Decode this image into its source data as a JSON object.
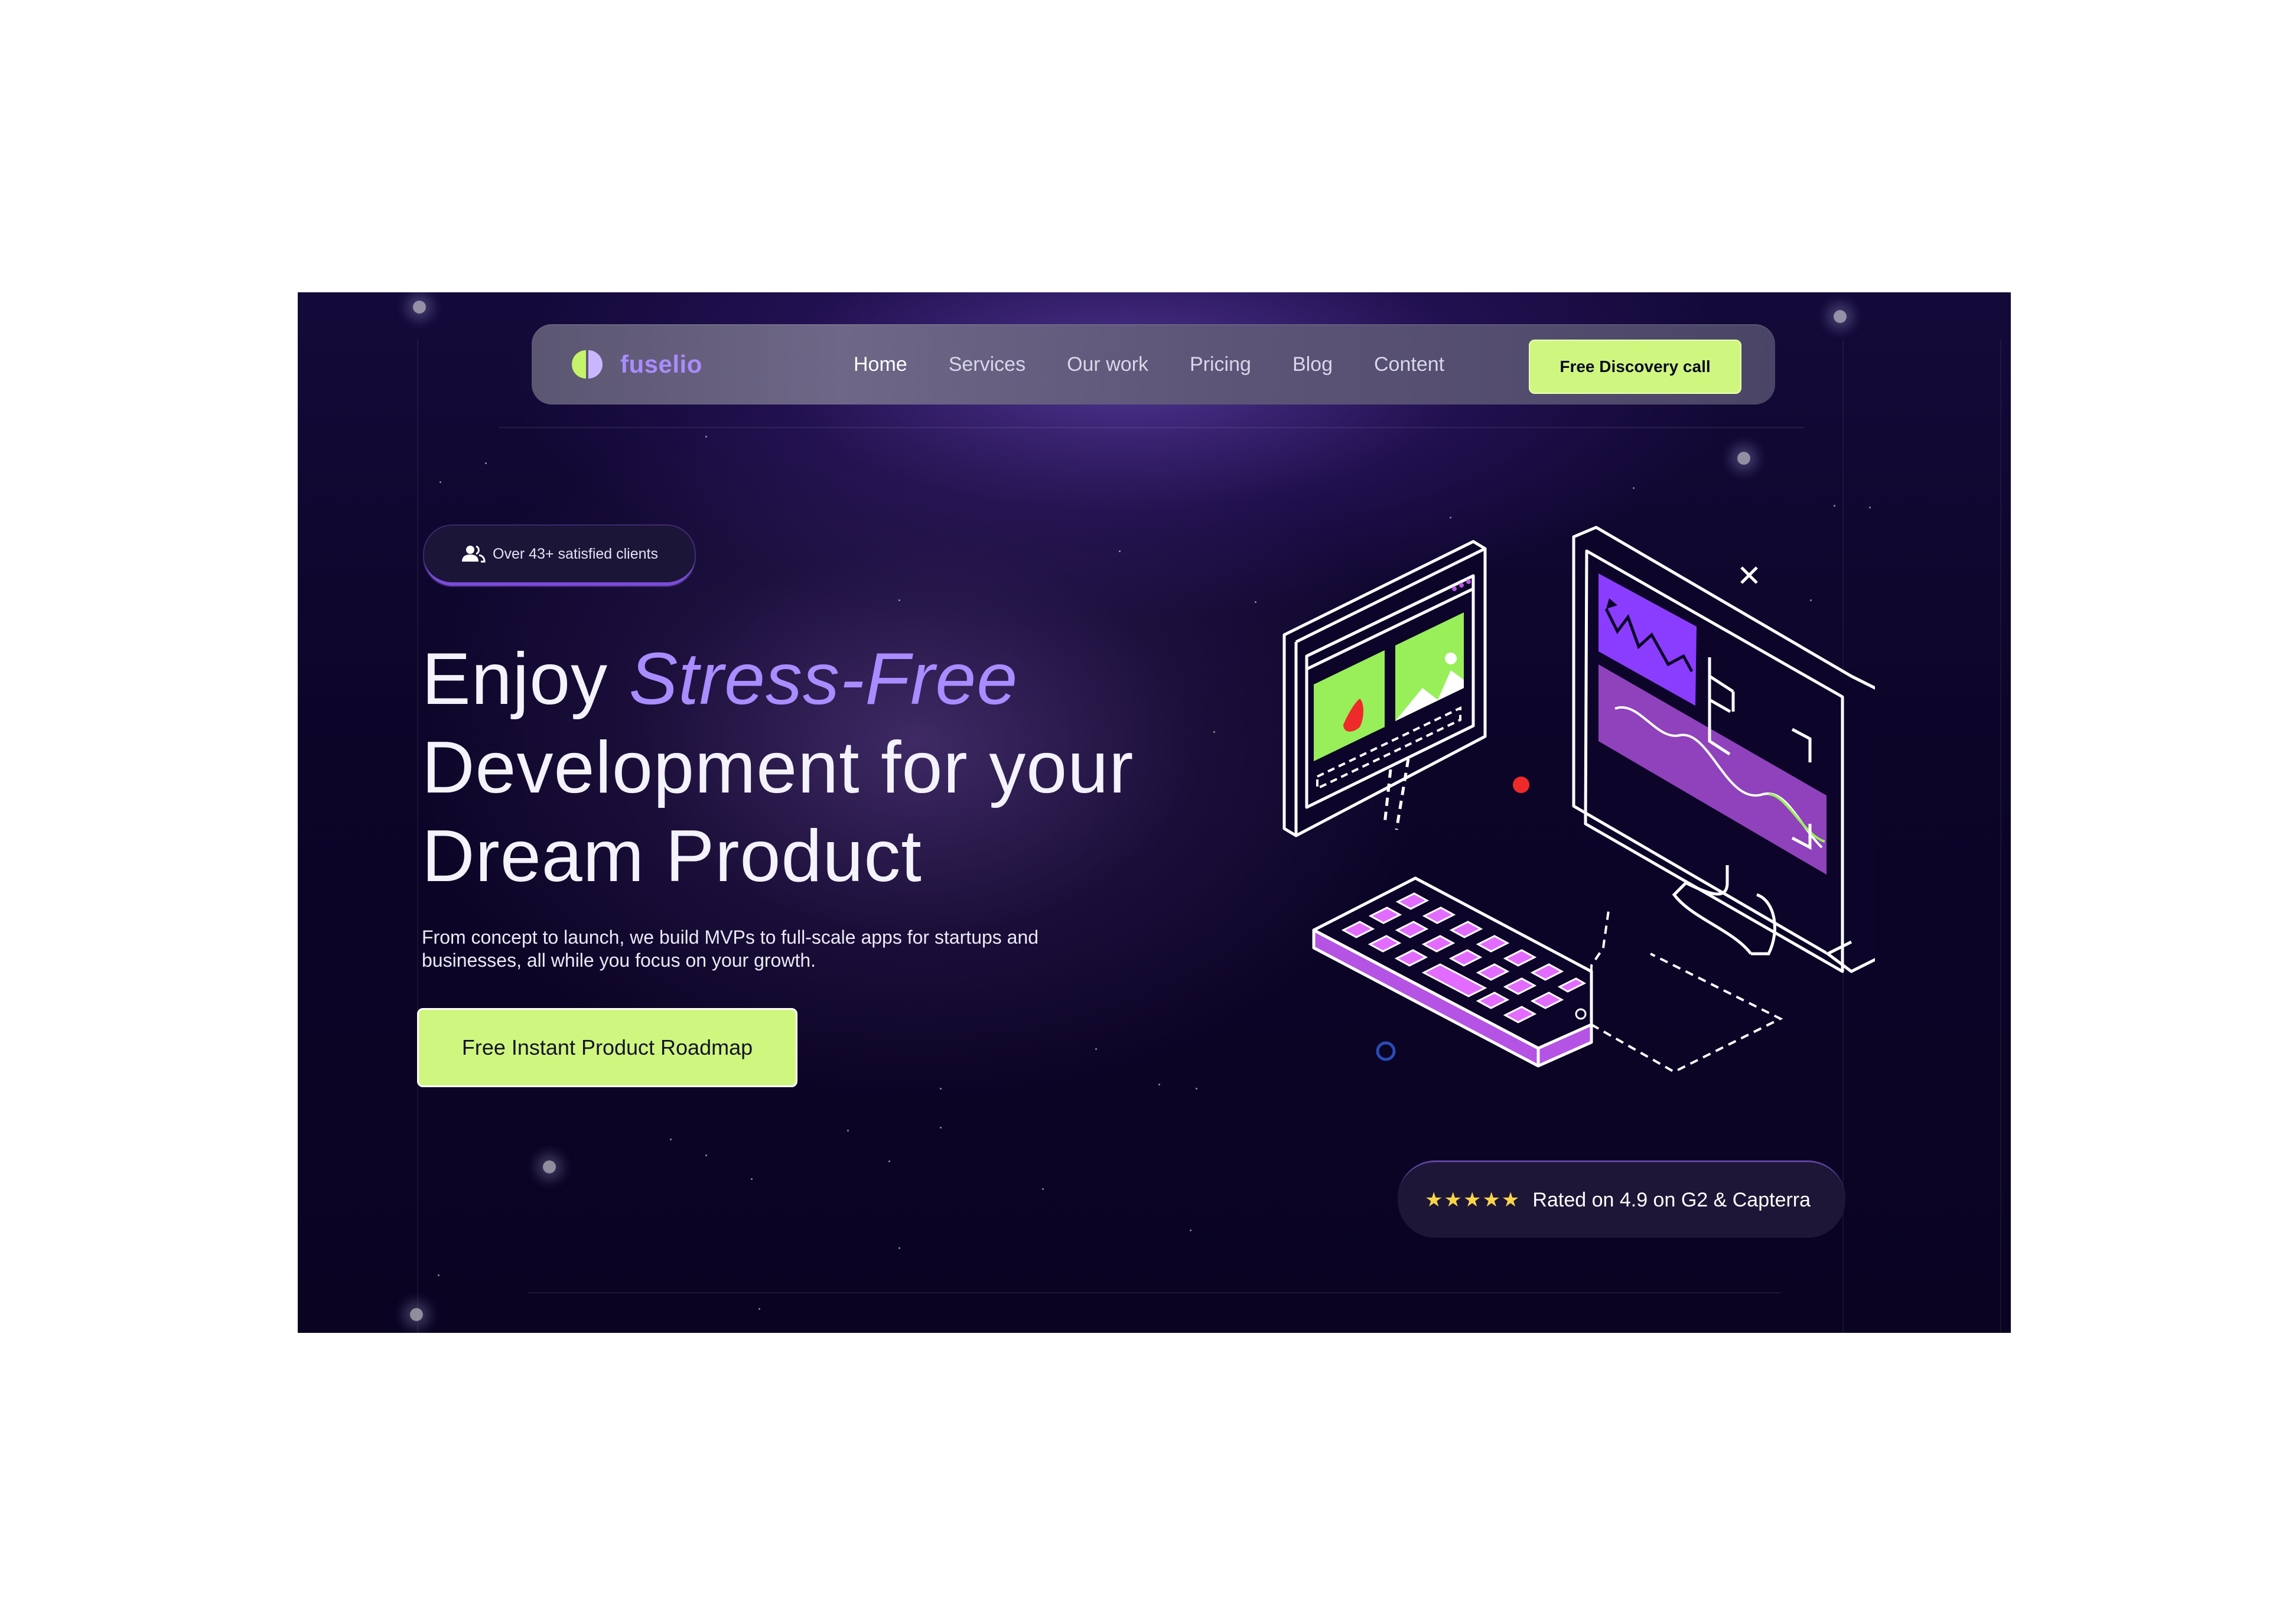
{
  "brand": {
    "name": "Fuselio",
    "logo_text": "fuselio"
  },
  "nav": {
    "links": [
      {
        "label": "Home",
        "active": true
      },
      {
        "label": "Services",
        "active": false
      },
      {
        "label": "Our work",
        "active": false
      },
      {
        "label": "Pricing",
        "active": false
      },
      {
        "label": "Blog",
        "active": false
      },
      {
        "label": "Content",
        "active": false
      }
    ],
    "cta_label": "Free Discovery call"
  },
  "hero": {
    "clients_badge": "Over 43+ satisfied clients",
    "headline_prefix": "Enjoy ",
    "headline_accent": "Stress-Free",
    "headline_line2": "Development for your",
    "headline_line3": "Dream Product",
    "subtext": "From concept to launch, we build MVPs to full-scale apps for startups and businesses, all while you focus on your growth.",
    "primary_cta": "Free Instant Product Roadmap"
  },
  "rating": {
    "stars": "★★★★★",
    "star_count": 5,
    "text": "Rated on 4.9 on G2 & Capterra"
  },
  "colors": {
    "accent_green": "#cff77f",
    "accent_purple": "#a98cff",
    "background_dark": "#0d0529",
    "illustration_purple": "#8b3dff",
    "illustration_green": "#98ef5a"
  },
  "icons": [
    "logo-mark-icon",
    "users-icon",
    "star-icon",
    "computer-illustration"
  ]
}
